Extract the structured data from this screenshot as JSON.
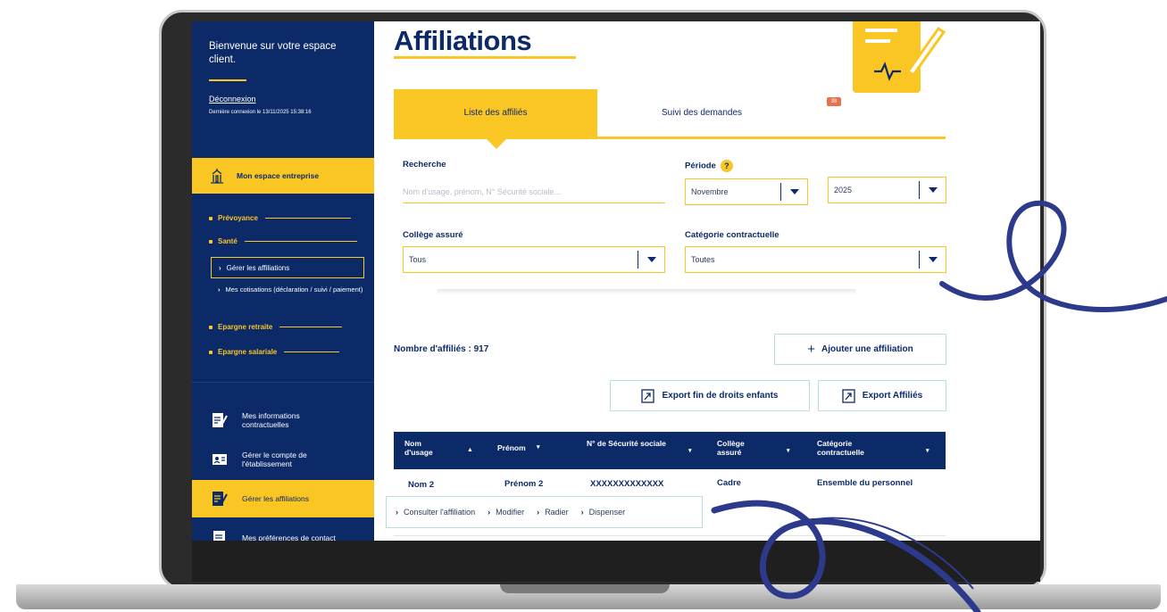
{
  "sidebar": {
    "welcome": "Bienvenue sur votre espace client.",
    "logout": "Déconnexion",
    "last_login": "Dernière connexion le 13/11/2025 15:38:16",
    "space_button": "Mon espace entreprise",
    "menu": [
      {
        "label": "Prévoyance"
      },
      {
        "label": "Santé"
      },
      {
        "label": "Epargne retraite"
      },
      {
        "label": "Epargne salariale"
      }
    ],
    "submenu_active": "Gérer les affiliations",
    "submenu_other": "Mes cotisations (déclaration / suivi / paiement)",
    "bottom_nav": [
      {
        "label": "Mes informations contractuelles",
        "icon": "document-edit-icon"
      },
      {
        "label": "Gérer le compte de l'établissement",
        "icon": "id-card-icon"
      },
      {
        "label": "Gérer les affiliations",
        "icon": "document-edit-icon"
      },
      {
        "label": "Mes préférences de contact",
        "icon": "document-icon"
      }
    ]
  },
  "main": {
    "title": "Affiliations",
    "tabs": [
      {
        "label": "Liste des affiliés"
      },
      {
        "label": "Suivi des demandes"
      }
    ],
    "tab_badge": "38",
    "filters": {
      "search_label": "Recherche",
      "search_placeholder": "Nom d'usage, prénom, N° Sécurité sociale...",
      "period_label": "Période",
      "help": "?",
      "month": "Novembre",
      "year": "2025",
      "college_label": "Collège assuré",
      "college_value": "Tous",
      "category_label": "Catégorie contractuelle",
      "category_value": "Toutes"
    },
    "count": "Nombre d'affiliés : 917",
    "buttons": {
      "add": "Ajouter une affiliation",
      "add_symbol": "+",
      "export_children": "Export fin de droits enfants",
      "export_affiliates": "Export Affiliés"
    },
    "table": {
      "headers": [
        "Nom d'usage",
        "Prénom",
        "N° de Sécurité sociale",
        "Collège assuré",
        "Catégorie contractuelle"
      ],
      "sort_symbols": [
        "▲",
        "▾",
        "▾",
        "▾",
        "▾"
      ],
      "row": [
        "Nom 2",
        "Prénom 2",
        "XXXXXXXXXXXXX",
        "Cadre",
        "Ensemble du personnel"
      ],
      "actions": [
        "Consulter l'affiliation",
        "Modifier",
        "Radier",
        "Dispenser"
      ],
      "chevron": "›"
    }
  },
  "colors": {
    "navy": "#0d2a68",
    "yellow": "#f9c623",
    "teal_border": "#b6dfe0",
    "badge": "#e8734a",
    "swirl": "#2d3a8c"
  }
}
